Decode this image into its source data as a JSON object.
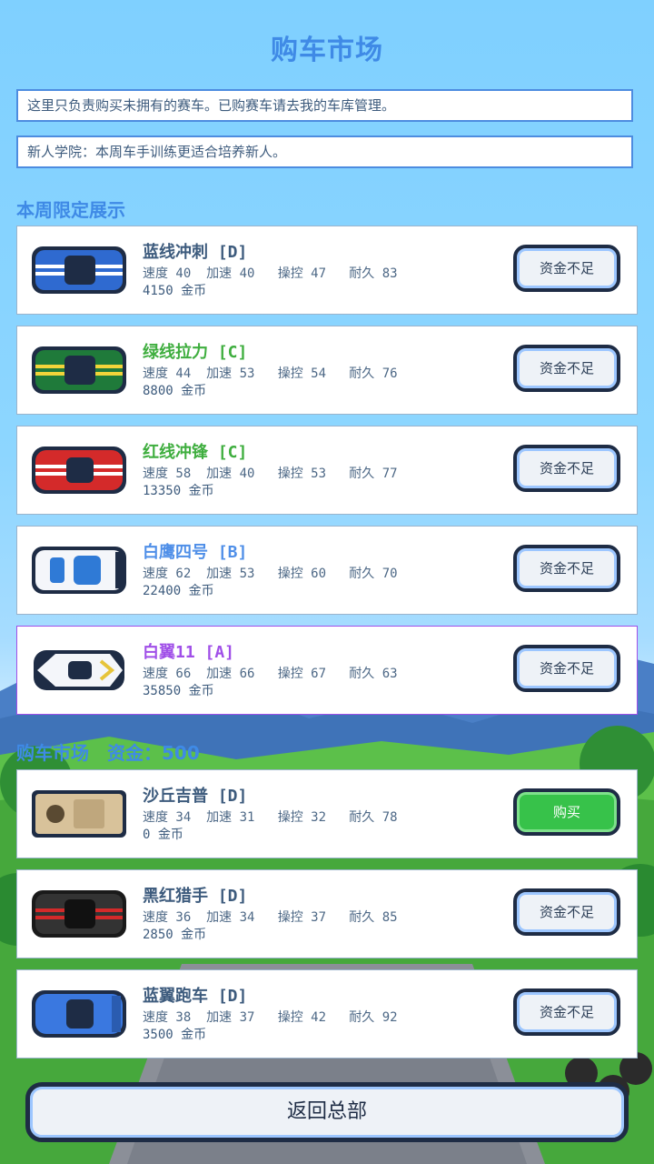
{
  "header": {
    "title": "购车市场"
  },
  "notices": [
    "这里只负责购买未拥有的赛车。已购赛车请去我的车库管理。",
    "新人学院：本周车手训练更适合培养新人。"
  ],
  "sections": {
    "featured_title": "本周限定展示",
    "market_title": "购车市场　资金：500"
  },
  "colors": {
    "accent": "#3f8ae6",
    "grade_d": "#3d5b7d",
    "grade_c": "#3fae3f",
    "grade_b": "#4f8fe8",
    "grade_a": "#a04fe8",
    "buy_green": "#37c24a"
  },
  "featured": [
    {
      "name": "蓝线冲刺 [D]",
      "stats": "速度 40  加速 40   操控 47   耐久 83",
      "price": "4150 金币",
      "button": "资金不足",
      "grade_color": "#3d5b7d",
      "car_icon": "blue-stripe-car-icon"
    },
    {
      "name": "绿线拉力 [C]",
      "stats": "速度 44  加速 53   操控 54   耐久 76",
      "price": "8800 金币",
      "button": "资金不足",
      "grade_color": "#3fae3f",
      "car_icon": "green-stripe-car-icon"
    },
    {
      "name": "红线冲锋 [C]",
      "stats": "速度 58  加速 40   操控 53   耐久 77",
      "price": "13350 金币",
      "button": "资金不足",
      "grade_color": "#3fae3f",
      "car_icon": "red-stripe-car-icon"
    },
    {
      "name": "白鹰四号 [B]",
      "stats": "速度 62  加速 53   操控 60   耐久 70",
      "price": "22400 金币",
      "button": "资金不足",
      "grade_color": "#4f8fe8",
      "car_icon": "white-blue-car-icon"
    },
    {
      "name": "白翼11 [A]",
      "stats": "速度 66  加速 66   操控 67   耐久 63",
      "price": "35850 金币",
      "button": "资金不足",
      "grade_color": "#a04fe8",
      "car_icon": "white-formula-car-icon"
    }
  ],
  "market": [
    {
      "name": "沙丘吉普 [D]",
      "stats": "速度 34  加速 31   操控 32   耐久 78",
      "price": "0 金币",
      "button": "购买",
      "buy": true,
      "grade_color": "#3d5b7d",
      "car_icon": "sand-jeep-icon"
    },
    {
      "name": "黑红猎手 [D]",
      "stats": "速度 36  加速 34   操控 37   耐久 85",
      "price": "2850 金币",
      "button": "资金不足",
      "grade_color": "#3d5b7d",
      "car_icon": "black-red-car-icon"
    },
    {
      "name": "蓝翼跑车 [D]",
      "stats": "速度 38  加速 37   操控 42   耐久 92",
      "price": "3500 金币",
      "button": "资金不足",
      "grade_color": "#3d5b7d",
      "car_icon": "blue-wing-car-icon"
    }
  ],
  "footer": {
    "back_label": "返回总部"
  }
}
